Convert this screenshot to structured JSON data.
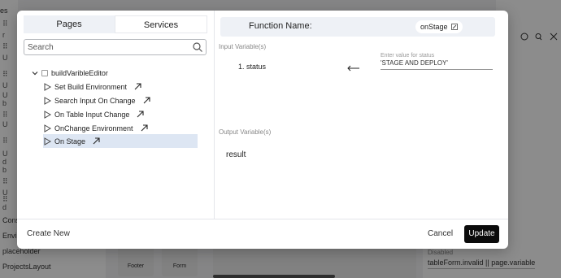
{
  "background": {
    "top_label": "es",
    "left_rows": [
      "r",
      "⠿",
      "U",
      "⠿",
      "U",
      "b",
      "U",
      "⠿",
      "U",
      "b",
      "⠿",
      "U",
      "⠿",
      "d",
      "⠿",
      "U",
      "⠿",
      "d"
    ],
    "left_bottom_items": [
      "Cons",
      "Envir",
      "placeholder",
      "ProjectsLayout"
    ],
    "footer_tiles": [
      "Footer",
      "Form"
    ],
    "disabled_label": "Disabled",
    "disabled_value": "tableForm.invalid || page.variable"
  },
  "modal": {
    "tabs": {
      "pages": "Pages",
      "services": "Services"
    },
    "search": {
      "placeholder": "Search"
    },
    "tree": {
      "root": "buildVaribleEditor",
      "items": [
        {
          "label": "Set Build Environment"
        },
        {
          "label": "Search Input On Change"
        },
        {
          "label": "On Table Input Change"
        },
        {
          "label": "OnChange Environment"
        },
        {
          "label": "On Stage"
        }
      ]
    },
    "function": {
      "label": "Function Name:",
      "name": "onStage"
    },
    "input": {
      "section_label": "Input Variable(s)",
      "variables": [
        {
          "label": "1. status",
          "hint": "Enter value for status",
          "value": "'STAGE AND DEPLOY'"
        }
      ]
    },
    "output": {
      "section_label": "Output Variable(s)",
      "value": "result"
    },
    "footer": {
      "create_new": "Create New",
      "cancel": "Cancel",
      "update": "Update"
    }
  },
  "colors": {
    "selected_row": "#dde6f3",
    "primary_button": "#0b0b0b",
    "header_bg": "#eef1f6"
  }
}
